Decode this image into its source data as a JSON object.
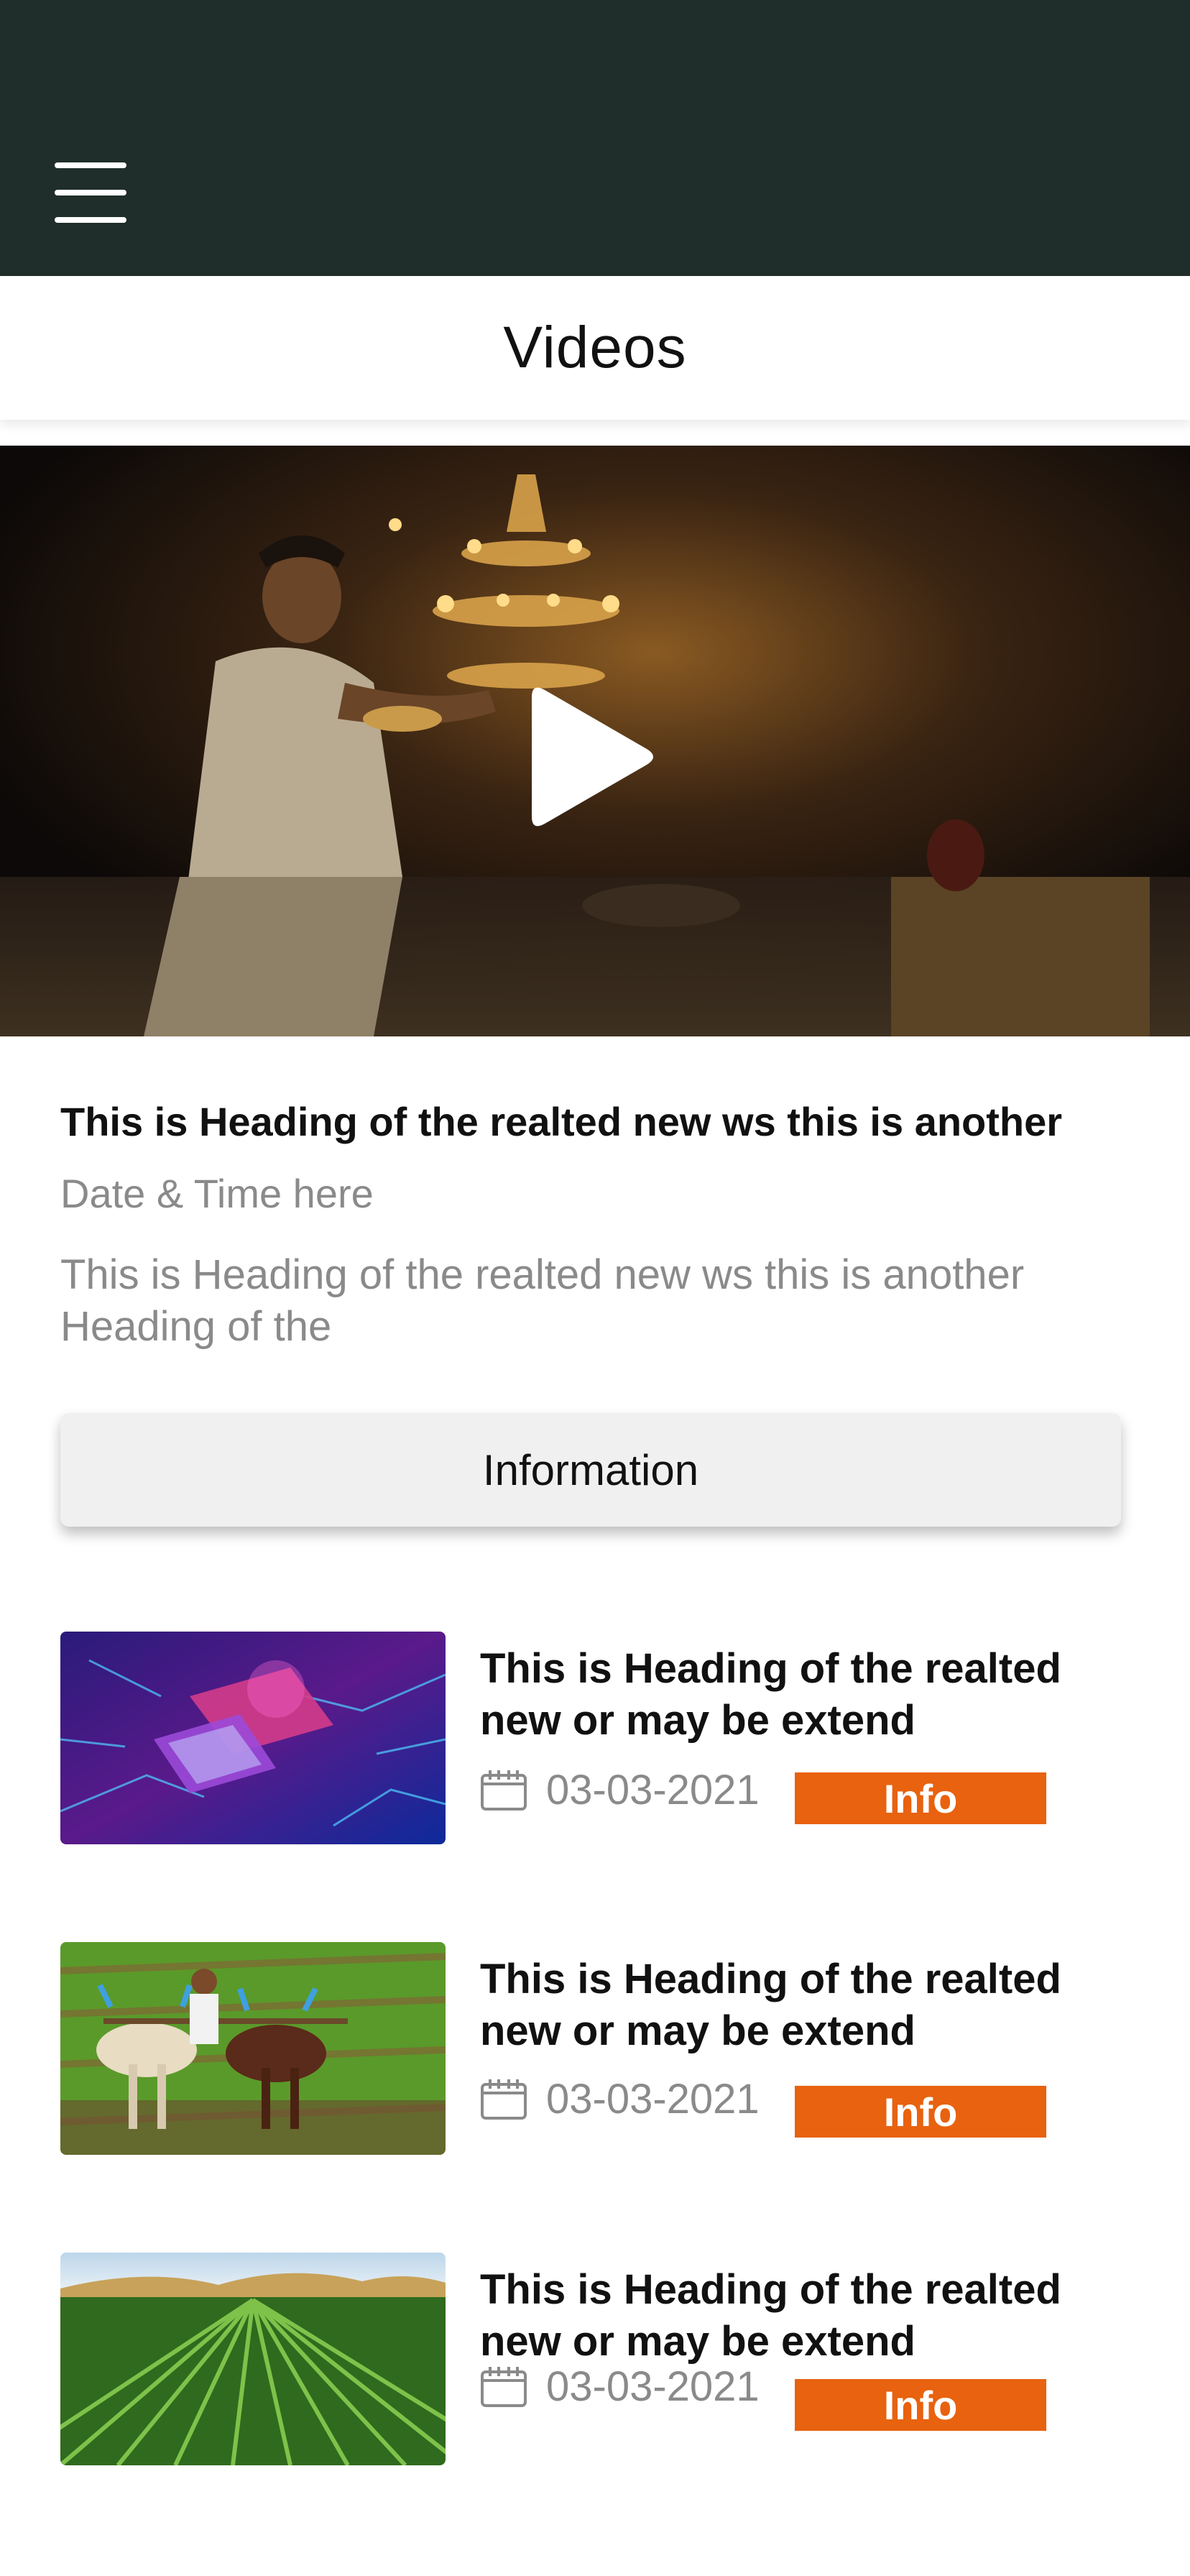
{
  "header": {
    "menu_icon": "hamburger-menu-icon",
    "title": "Videos"
  },
  "featured": {
    "play_icon": "play-icon",
    "heading": "This is Heading of the realted new ws this is another",
    "datetime": "Date & Time here",
    "description": "This is Heading of the realted new ws this is another Heading of the",
    "button_label": "Information"
  },
  "news": [
    {
      "title": "This is Heading of the realted new or may be extend",
      "date": "03-03-2021",
      "badge": "Info",
      "thumb": "circuit-chip"
    },
    {
      "title": "This is Heading of the realted new or may be extend",
      "date": "03-03-2021",
      "badge": "Info",
      "thumb": "farmer-oxen"
    },
    {
      "title": "This is Heading of the realted new or may be extend",
      "date": "03-03-2021",
      "badge": "Info",
      "thumb": "crop-field"
    }
  ],
  "colors": {
    "topbar": "#1f2e2a",
    "badge": "#e8620f",
    "muted_text": "#8a8a8a"
  }
}
